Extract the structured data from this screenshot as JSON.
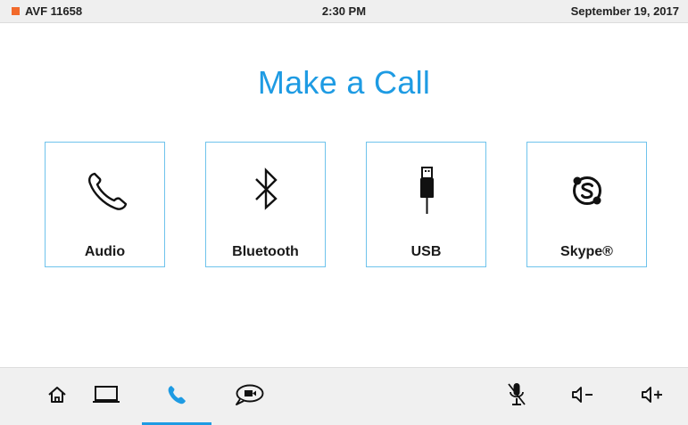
{
  "status_bar": {
    "room_name": "AVF 11658",
    "time": "2:30 PM",
    "date": "September 19, 2017",
    "indicator_color": "#f26a2b"
  },
  "main": {
    "title": "Make a Call",
    "accent_color": "#1e9be3",
    "tiles": [
      {
        "label": "Audio",
        "icon": "phone-icon"
      },
      {
        "label": "Bluetooth",
        "icon": "bluetooth-icon"
      },
      {
        "label": "USB",
        "icon": "usb-icon"
      },
      {
        "label": "Skype®",
        "icon": "skype-icon"
      }
    ]
  },
  "nav": {
    "items": [
      {
        "name": "home",
        "icon": "home-icon",
        "active": false
      },
      {
        "name": "share",
        "icon": "laptop-icon",
        "active": false
      },
      {
        "name": "call",
        "icon": "phone-icon",
        "active": true
      },
      {
        "name": "video-conference",
        "icon": "video-chat-icon",
        "active": false
      },
      {
        "name": "mic-mute",
        "icon": "mic-muted-icon",
        "active": false
      },
      {
        "name": "volume-down",
        "icon": "volume-down-icon",
        "active": false
      },
      {
        "name": "volume-up",
        "icon": "volume-up-icon",
        "active": false
      }
    ]
  }
}
